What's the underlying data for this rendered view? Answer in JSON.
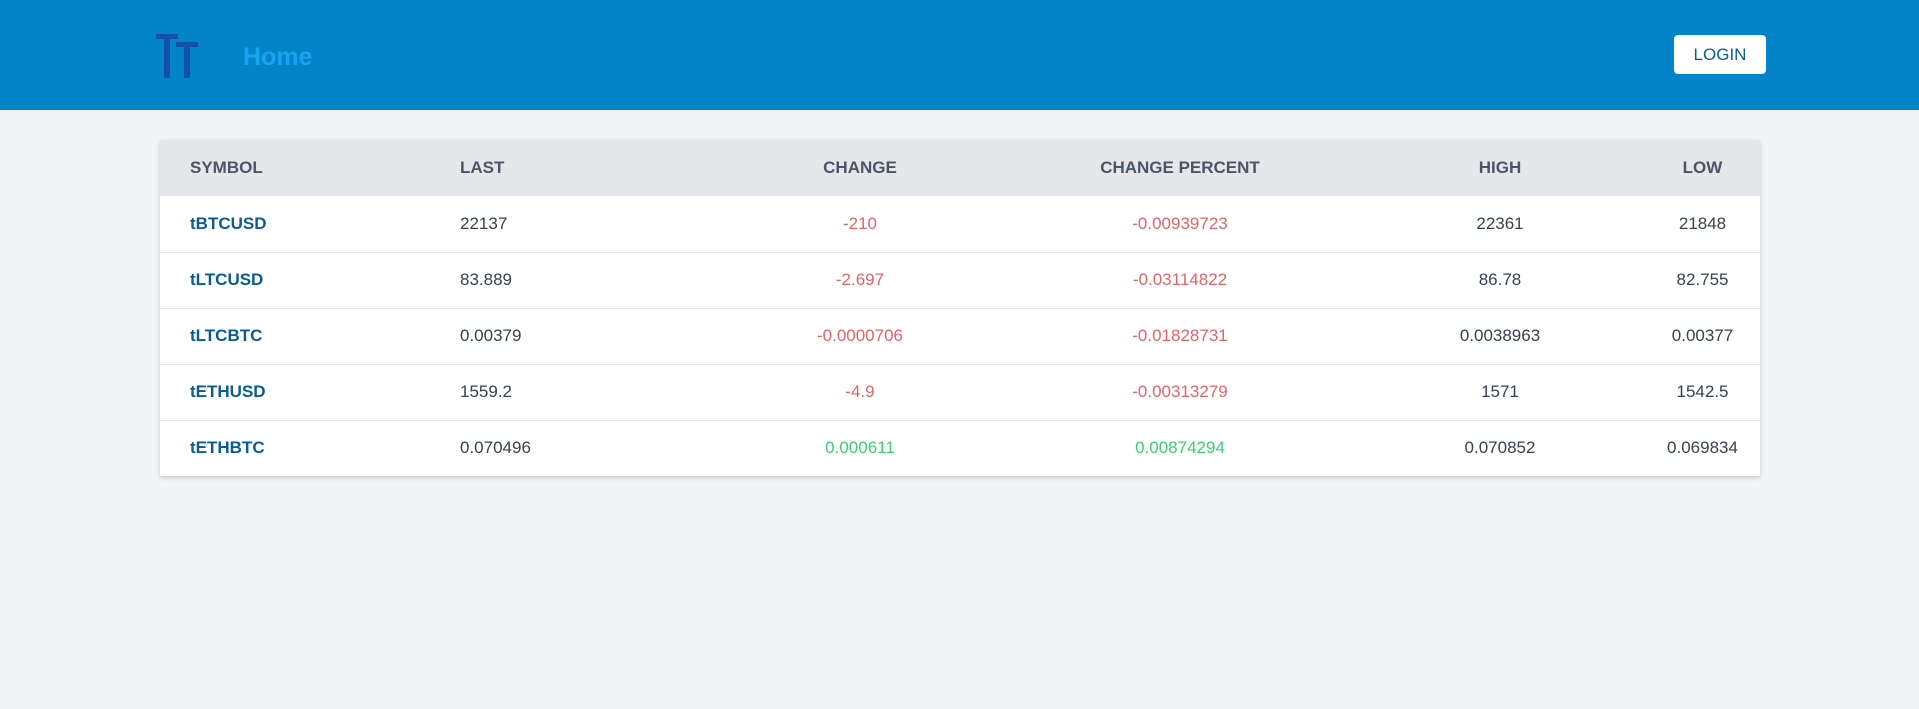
{
  "header": {
    "home_label": "Home",
    "login_label": "LOGIN",
    "logo_icon": "tt-logo-icon",
    "background_color": "#0384c8"
  },
  "table": {
    "columns": [
      "SYMBOL",
      "LAST",
      "CHANGE",
      "CHANGE PERCENT",
      "HIGH",
      "LOW"
    ],
    "rows": [
      {
        "symbol": "tBTCUSD",
        "last": "22137",
        "change": "-210",
        "change_percent": "-0.00939723",
        "high": "22361",
        "low": "21848",
        "direction": "down"
      },
      {
        "symbol": "tLTCUSD",
        "last": "83.889",
        "change": "-2.697",
        "change_percent": "-0.03114822",
        "high": "86.78",
        "low": "82.755",
        "direction": "down"
      },
      {
        "symbol": "tLTCBTC",
        "last": "0.00379",
        "change": "-0.0000706",
        "change_percent": "-0.01828731",
        "high": "0.0038963",
        "low": "0.00377",
        "direction": "down"
      },
      {
        "symbol": "tETHUSD",
        "last": "1559.2",
        "change": "-4.9",
        "change_percent": "-0.00313279",
        "high": "1571",
        "low": "1542.5",
        "direction": "down"
      },
      {
        "symbol": "tETHBTC",
        "last": "0.070496",
        "change": "0.000611",
        "change_percent": "0.00874294",
        "high": "0.070852",
        "low": "0.069834",
        "direction": "up"
      }
    ]
  },
  "colors": {
    "negative": "#e0656a",
    "positive": "#3ccf72",
    "symbol": "#0a5d8c"
  }
}
